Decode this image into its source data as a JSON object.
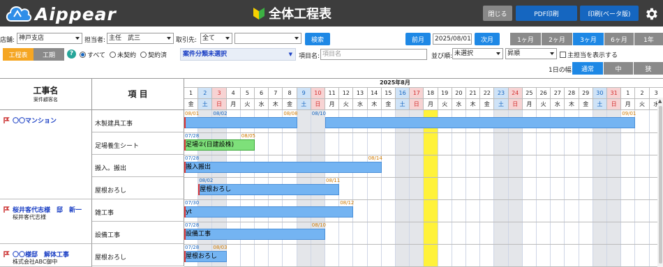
{
  "header": {
    "logo_text": "Aippear",
    "title": "全体工程表",
    "close_label": "閉じる",
    "pdf_label": "PDF印刷",
    "print_beta_label": "印刷(ベータ版)"
  },
  "filters": {
    "store_label": "店舗:",
    "store_value": "神戸支店",
    "staff_label": "担当者:",
    "staff_value": "主任　武三",
    "client_label": "取引先:",
    "client_value": "全て",
    "client_detail_value": "",
    "search_label": "検索",
    "prev_month_label": "前月",
    "date_value": "2025/08/01",
    "next_month_label": "次月",
    "range_options": [
      "1ヶ月",
      "2ヶ月",
      "3ヶ月",
      "6ヶ月",
      "1年"
    ],
    "range_selected": 2
  },
  "row2": {
    "tab_schedule": "工程表",
    "tab_period": "工期",
    "help_icon": "?",
    "radio_all": "すべて",
    "radio_uncontracted": "未契約",
    "radio_contracted": "契約済",
    "category_value": "案件分類未選択",
    "item_name_label": "項目名:",
    "item_name_placeholder": "項目名",
    "sort_label": "並び順:",
    "sort_value": "未選択",
    "order_value": "昇順",
    "show_sub_label": "主担当を表示する"
  },
  "row3": {
    "width_label": "1日の幅:",
    "width_options": [
      "通常",
      "中",
      "狭"
    ],
    "width_selected": 0
  },
  "table": {
    "col_project": "工事名",
    "col_project_sub": "案件顧客名",
    "col_item": "項 目",
    "month_label": "2025年8月",
    "days": [
      "1",
      "2",
      "3",
      "4",
      "5",
      "6",
      "7",
      "8",
      "9",
      "10",
      "11",
      "12",
      "13",
      "14",
      "15",
      "16",
      "17",
      "18",
      "19",
      "20",
      "21",
      "22",
      "23",
      "24",
      "25",
      "26",
      "27",
      "28",
      "29",
      "30",
      "31",
      "1",
      "2",
      "3"
    ],
    "weekdays": [
      "金",
      "土",
      "日",
      "月",
      "火",
      "水",
      "木",
      "金",
      "土",
      "日",
      "月",
      "火",
      "水",
      "木",
      "金",
      "土",
      "日",
      "月",
      "火",
      "水",
      "木",
      "金",
      "土",
      "日",
      "月",
      "火",
      "水",
      "木",
      "金",
      "土",
      "日",
      "月",
      "火",
      "水"
    ],
    "projects": [
      {
        "name": "〇〇マンション",
        "client": ""
      },
      {
        "name": "桜井客代志様　邸　新一",
        "client": "桜井客代志様"
      },
      {
        "name": "〇〇様邸　解体工事",
        "client": "株式会社ABC御中"
      }
    ],
    "rows": [
      {
        "item": "木製建具工事",
        "bar_label": "",
        "tags": [
          "08/01",
          "08/02",
          "08/08",
          "08/10",
          "09/01"
        ]
      },
      {
        "item": "足場養生シート",
        "bar_label": "足場②(日建設株)",
        "tags": [
          "07/28",
          "08/05"
        ]
      },
      {
        "item": "搬入。搬出",
        "bar_label": "搬入搬出",
        "tags": [
          "07/28",
          "08/14"
        ]
      },
      {
        "item": "屋根おろし",
        "bar_label": "屋根おろし",
        "tags": [
          "08/02",
          "08/11"
        ]
      },
      {
        "item": "雑工事",
        "bar_label": "yt",
        "tags": [
          "07/30",
          "08/12"
        ]
      },
      {
        "item": "設備工事",
        "bar_label": "設備工事",
        "tags": [
          "07/28",
          "08/10"
        ]
      },
      {
        "item": "屋根おろし",
        "bar_label": "屋根おろし",
        "tags": [
          "07/28",
          "08/03"
        ]
      }
    ]
  },
  "colors": {
    "header_bg": "#3d3d3d",
    "accent_blue": "#1e88e5",
    "tab_orange": "#f5a623",
    "bar_blue": "#74b4f2",
    "bar_green": "#7ee07a",
    "today_yellow": "#fff23a",
    "saturday_bg": "#cfe3f7",
    "sunday_bg": "#f7d3d3"
  }
}
